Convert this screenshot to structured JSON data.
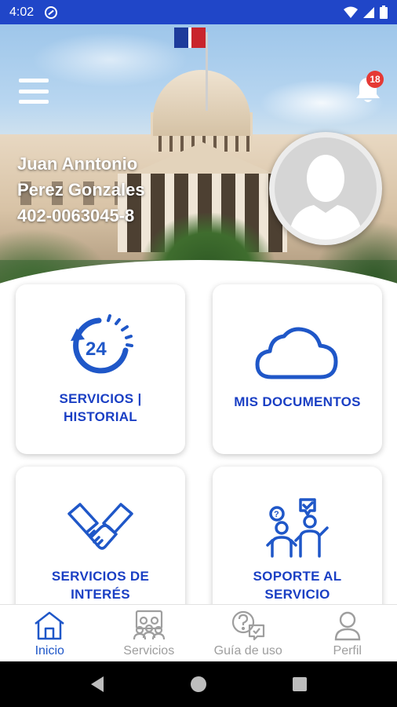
{
  "status_bar": {
    "time": "4:02",
    "icons": [
      "app-notification-icon",
      "wifi-icon",
      "signal-icon",
      "battery-icon"
    ]
  },
  "header": {
    "menu_icon": "hamburger-menu-icon",
    "notifications": {
      "icon": "bell-icon",
      "count": "18"
    },
    "user": {
      "first_name": "Juan Anntonio",
      "last_name": "Perez Gonzales",
      "id_number": "402-0063045-8"
    },
    "avatar_icon": "user-silhouette-icon"
  },
  "cards": [
    {
      "icon": "clock-24-icon",
      "label_line1": "SERVICIOS |",
      "label_line2": "HISTORIAL"
    },
    {
      "icon": "cloud-icon",
      "label_line1": "MIS DOCUMENTOS",
      "label_line2": ""
    },
    {
      "icon": "handshake-icon",
      "label_line1": "SERVICIOS DE",
      "label_line2": "INTERÉS"
    },
    {
      "icon": "support-people-icon",
      "label_line1": "SOPORTE AL",
      "label_line2": "SERVICIO"
    }
  ],
  "bottom_nav": [
    {
      "label": "Inicio",
      "icon": "home-icon",
      "active": true
    },
    {
      "label": "Servicios",
      "icon": "people-group-icon",
      "active": false
    },
    {
      "label": "Guía de uso",
      "icon": "help-chat-icon",
      "active": false
    },
    {
      "label": "Perfil",
      "icon": "person-icon",
      "active": false
    }
  ],
  "colors": {
    "primary": "#2046c8",
    "card_text": "#1a3fc4",
    "badge": "#e53935",
    "nav_active": "#1f57c8",
    "nav_inactive": "#9e9e9e"
  }
}
